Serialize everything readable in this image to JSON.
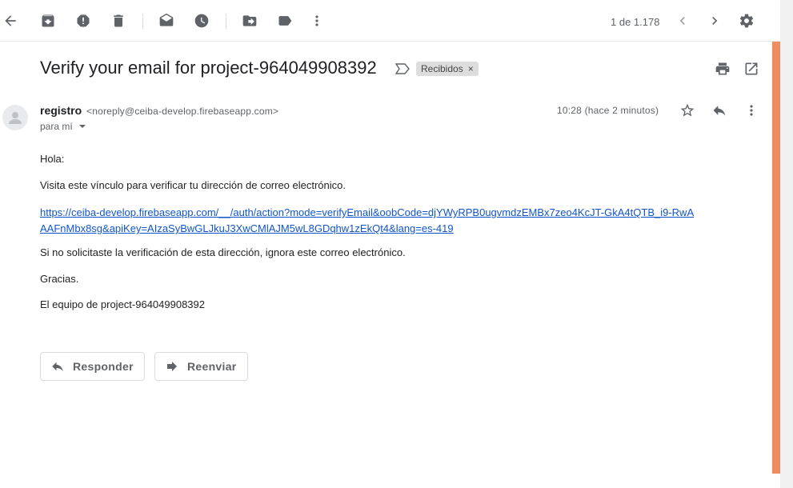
{
  "toolbar": {
    "pager_text": "1 de 1.178"
  },
  "message": {
    "subject": "Verify your email for project-964049908392",
    "label": "Recibidos",
    "label_close": "×",
    "sender_name": "registro",
    "sender_email": "<noreply@ceiba-develop.firebaseapp.com>",
    "to": "para mí",
    "time": "10:28 (hace 2 minutos)"
  },
  "body": {
    "greeting": "Hola:",
    "line1": "Visita este vínculo para verificar tu dirección de correo electrónico.",
    "link": "https://ceiba-develop.firebaseapp.com/__/auth/action?mode=verifyEmail&oobCode=djYWyRPB0ugvmdzEMBx7zeo4KcJT-GkA4tQTB_i9-RwAAAFnMbx8sg&apiKey=AIzaSyBwGLJkuJ3XwCMlAJM5wL8GDqhw1zEkQt4&lang=es-419",
    "line2": "Si no solicitaste la verificación de esta dirección, ignora este correo electrónico.",
    "thanks": "Gracias.",
    "signature": "El equipo de project-964049908392"
  },
  "actions": {
    "reply": "Responder",
    "forward": "Reenviar"
  },
  "colors": {
    "link": "#1155cc",
    "scroll_accent": "#f28b5e"
  }
}
